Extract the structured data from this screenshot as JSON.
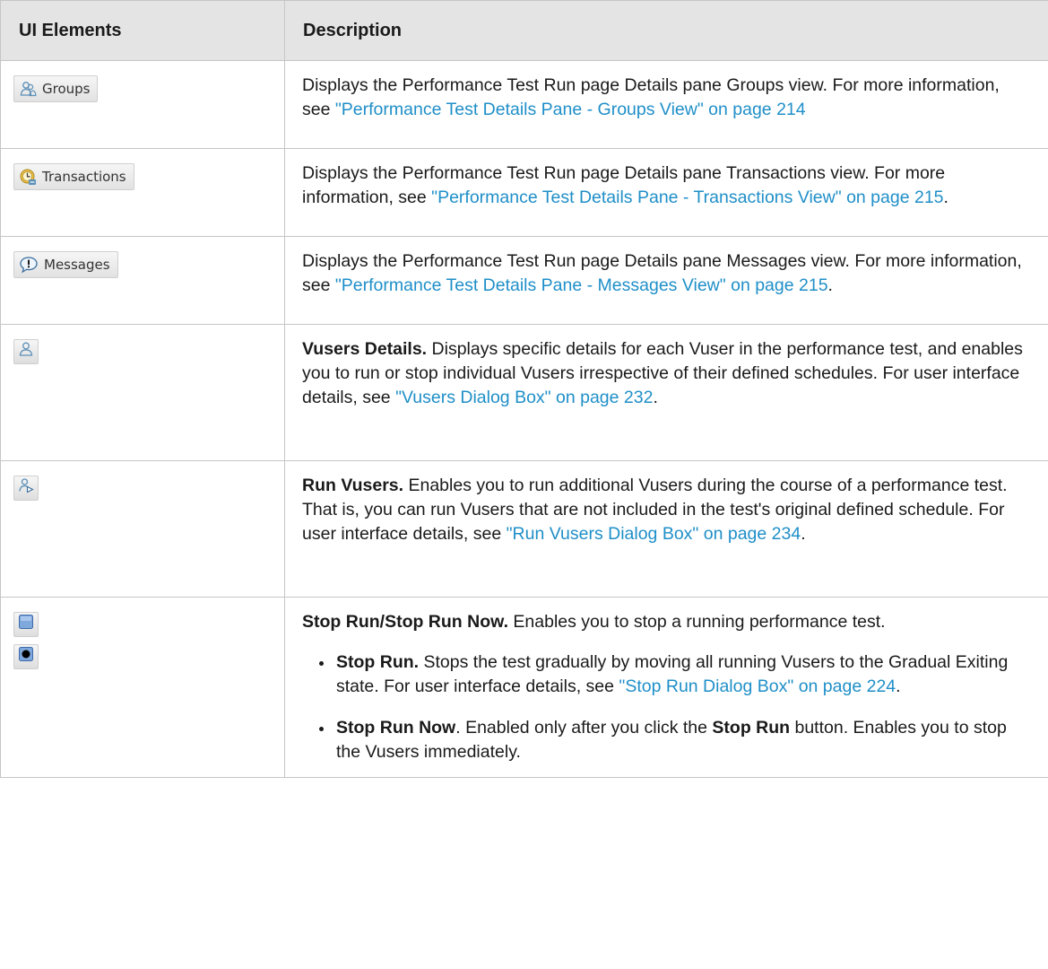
{
  "header": {
    "col1": "UI Elements",
    "col2": "Description"
  },
  "rows": [
    {
      "icon": "groups-icon",
      "button_label": "Groups",
      "text": "Displays the Performance Test Run page Details pane Groups view. For more information, see ",
      "link": "\"Performance Test Details Pane - Groups View\" on page 214",
      "tail": ""
    },
    {
      "icon": "transactions-icon",
      "button_label": "Transactions",
      "text": "Displays the Performance Test Run page Details pane Transactions view. For more information, see ",
      "link": "\"Performance Test Details Pane - Transactions View\" on page 215",
      "tail": "."
    },
    {
      "icon": "messages-icon",
      "button_label": "Messages",
      "text": "Displays the Performance Test Run page Details pane Messages view. For more information, see ",
      "link": "\"Performance Test Details Pane - Messages View\" on page 215",
      "tail": "."
    },
    {
      "icon": "vusers-details-icon",
      "bold": "Vusers Details.",
      "text": " Displays specific details for each Vuser in the performance test, and enables you to run or stop individual Vusers irrespective of their defined schedules. For user interface details, see ",
      "link": "\"Vusers Dialog Box\" on page 232",
      "tail": "."
    },
    {
      "icon": "run-vusers-icon",
      "bold": "Run Vusers.",
      "text": " Enables you to run additional Vusers during the course of a performance test. That is, you can run Vusers that are not included in the test's original defined schedule. For user interface details, see ",
      "link": "\"Run Vusers Dialog Box\" on page 234",
      "tail": "."
    },
    {
      "icons": [
        "stop-run-icon",
        "stop-run-now-icon"
      ],
      "bold": "Stop Run/Stop Run Now.",
      "text": " Enables you to stop a running performance test.",
      "bullets": [
        {
          "bold": "Stop Run.",
          "text": " Stops the test gradually by moving all running Vusers to the Gradual Exiting state. For user interface details, see ",
          "link": "\"Stop Run Dialog Box\" on page 224",
          "tail": "."
        },
        {
          "bold": "Stop Run Now",
          "text": ". Enabled only after you click the ",
          "bold2": "Stop Run",
          "tail": " button. Enables you to stop the Vusers immediately."
        }
      ]
    }
  ],
  "colors": {
    "link": "#1f8fc8",
    "header_bg": "#e4e4e4",
    "border": "#c6c6c6"
  }
}
